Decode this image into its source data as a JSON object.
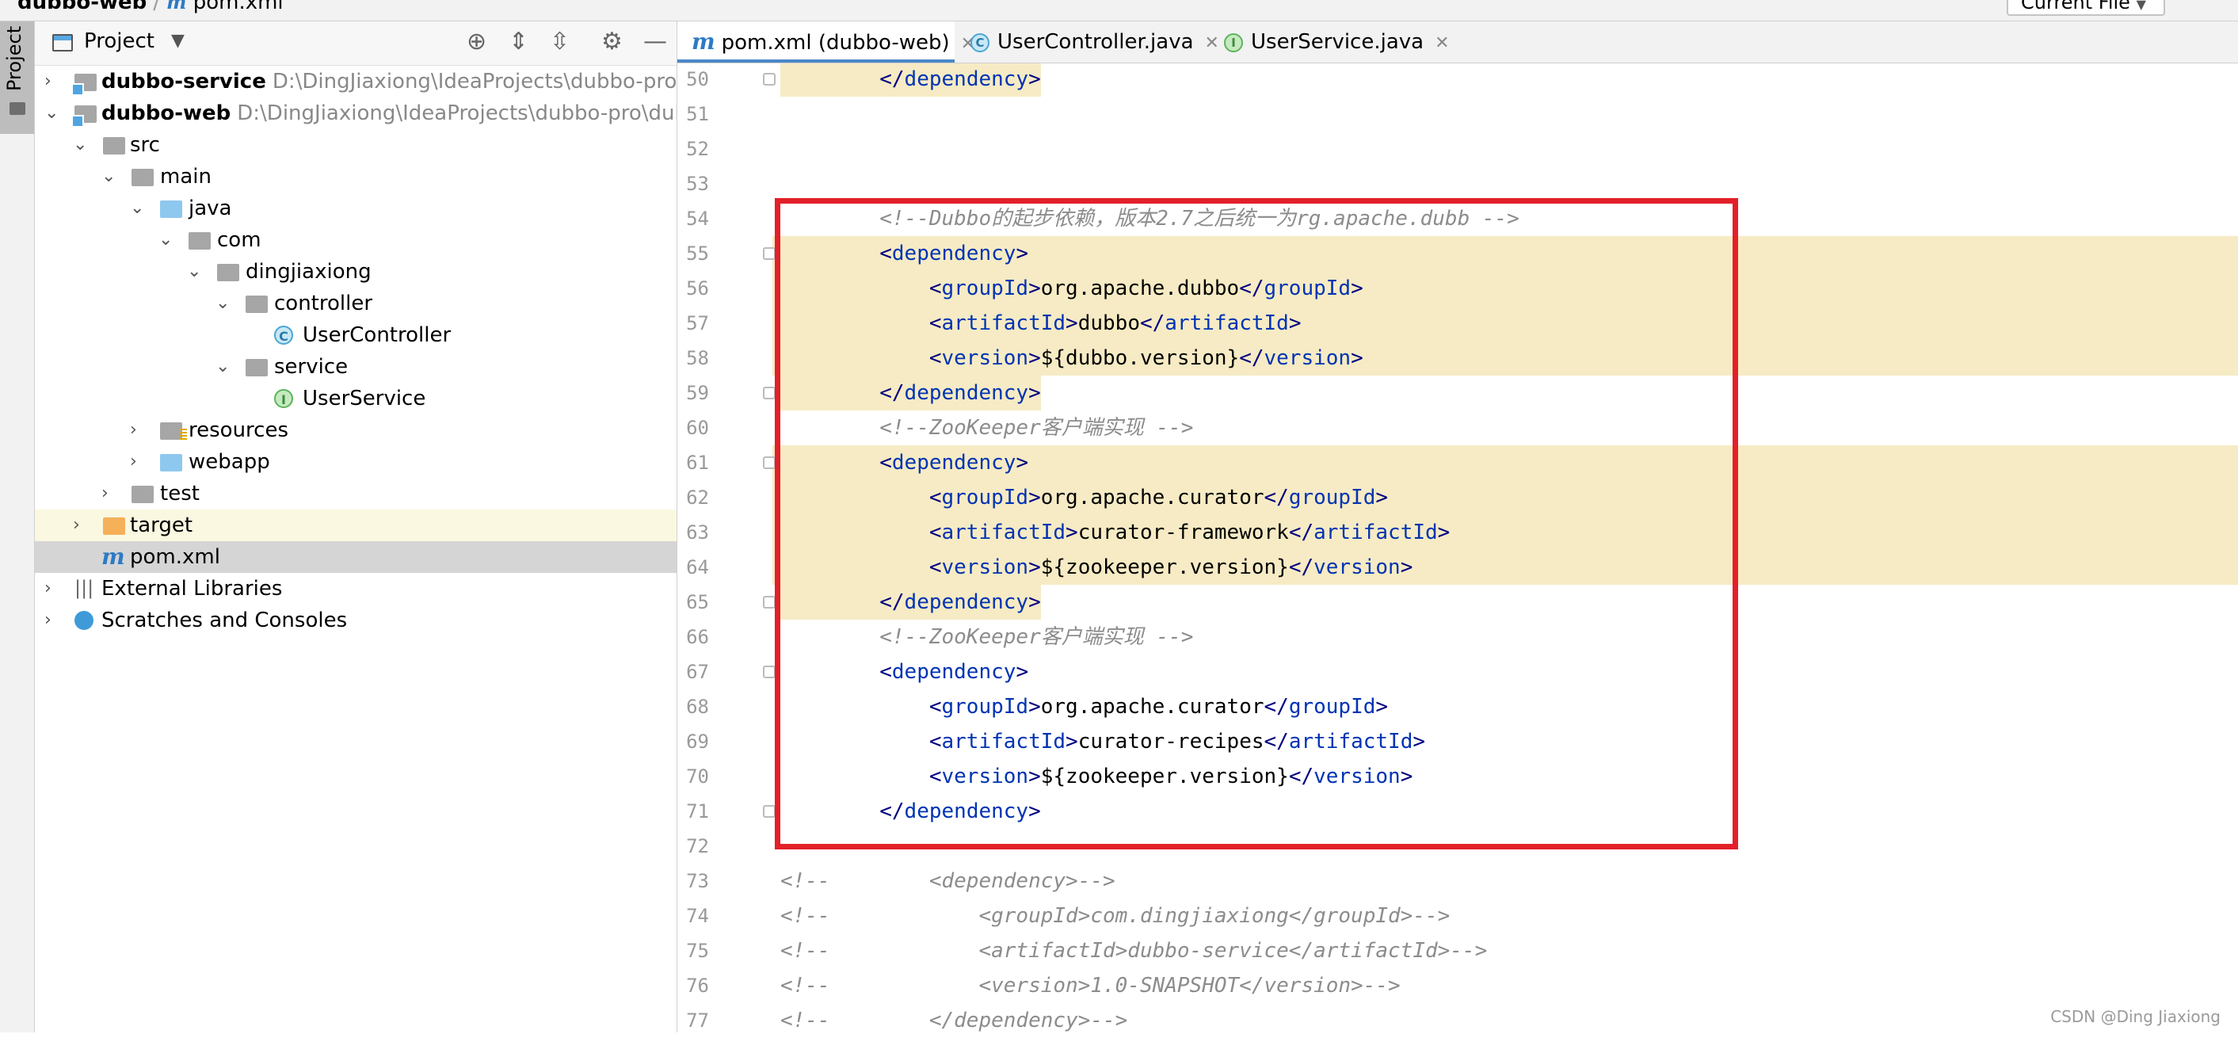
{
  "topbar": {
    "project": "dubbo-web",
    "file": "pom.xml",
    "config": "Current File"
  },
  "toolstrip": {
    "project_tab": "Project"
  },
  "project_panel": {
    "title": "Project",
    "tree": [
      {
        "label": "dubbo-service",
        "path": "D:\\DingJiaxiong\\IdeaProjects\\dubbo-pro\\dubbo",
        "icon": "module-folder-icon"
      },
      {
        "label": "dubbo-web",
        "path": "D:\\DingJiaxiong\\IdeaProjects\\dubbo-pro\\dubbo-w",
        "icon": "module-folder-icon"
      },
      {
        "label": "src",
        "icon": "folder-icon"
      },
      {
        "label": "main",
        "icon": "folder-icon"
      },
      {
        "label": "java",
        "icon": "source-folder-icon"
      },
      {
        "label": "com",
        "icon": "package-icon"
      },
      {
        "label": "dingjiaxiong",
        "icon": "package-icon"
      },
      {
        "label": "controller",
        "icon": "package-icon"
      },
      {
        "label": "UserController",
        "icon": "class-icon"
      },
      {
        "label": "service",
        "icon": "package-icon"
      },
      {
        "label": "UserService",
        "icon": "interface-icon"
      },
      {
        "label": "resources",
        "icon": "resources-folder-icon"
      },
      {
        "label": "webapp",
        "icon": "web-folder-icon"
      },
      {
        "label": "test",
        "icon": "folder-icon"
      },
      {
        "label": "target",
        "icon": "excluded-folder-icon"
      },
      {
        "label": "pom.xml",
        "icon": "maven-icon"
      },
      {
        "label": "External Libraries",
        "icon": "libraries-icon"
      },
      {
        "label": "Scratches and Consoles",
        "icon": "scratches-icon"
      }
    ]
  },
  "tabs": [
    {
      "label": "pom.xml (dubbo-web)",
      "icon": "maven-icon",
      "icon_letter": "m"
    },
    {
      "label": "UserController.java",
      "icon": "class-icon",
      "icon_letter": "C"
    },
    {
      "label": "UserService.java",
      "icon": "interface-icon",
      "icon_letter": "I"
    }
  ],
  "editor": {
    "line_numbers": [
      "50",
      "51",
      "52",
      "53",
      "54",
      "55",
      "56",
      "57",
      "58",
      "59",
      "60",
      "61",
      "62",
      "63",
      "64",
      "65",
      "66",
      "67",
      "68",
      "69",
      "70",
      "71",
      "72",
      "73",
      "74",
      "75",
      "76",
      "77"
    ],
    "lines": [
      [
        "        ",
        "</",
        "dependency",
        ">"
      ],
      [
        ""
      ],
      [
        ""
      ],
      [
        ""
      ],
      [
        "        ",
        "<!--Dubbo的起步依赖，版本2.7之后统一为rg.apache.dubb -->"
      ],
      [
        "        ",
        "<",
        "dependency",
        ">"
      ],
      [
        "            ",
        "<",
        "groupId",
        ">",
        "org.apache.dubbo",
        "</",
        "groupId",
        ">"
      ],
      [
        "            ",
        "<",
        "artifactId",
        ">",
        "dubbo",
        "</",
        "artifactId",
        ">"
      ],
      [
        "            ",
        "<",
        "version",
        ">",
        "${dubbo.version}",
        "</",
        "version",
        ">"
      ],
      [
        "        ",
        "</",
        "dependency",
        ">"
      ],
      [
        "        ",
        "<!--ZooKeeper客户端实现 -->"
      ],
      [
        "        ",
        "<",
        "dependency",
        ">"
      ],
      [
        "            ",
        "<",
        "groupId",
        ">",
        "org.apache.curator",
        "</",
        "groupId",
        ">"
      ],
      [
        "            ",
        "<",
        "artifactId",
        ">",
        "curator-framework",
        "</",
        "artifactId",
        ">"
      ],
      [
        "            ",
        "<",
        "version",
        ">",
        "${zookeeper.version}",
        "</",
        "version",
        ">"
      ],
      [
        "        ",
        "</",
        "dependency",
        ">"
      ],
      [
        "        ",
        "<!--ZooKeeper客户端实现 -->"
      ],
      [
        "        ",
        "<",
        "dependency",
        ">"
      ],
      [
        "            ",
        "<",
        "groupId",
        ">",
        "org.apache.curator",
        "</",
        "groupId",
        ">"
      ],
      [
        "            ",
        "<",
        "artifactId",
        ">",
        "curator-recipes",
        "</",
        "artifactId",
        ">"
      ],
      [
        "            ",
        "<",
        "version",
        ">",
        "${zookeeper.version}",
        "</",
        "version",
        ">"
      ],
      [
        "        ",
        "</",
        "dependency",
        ">"
      ],
      [
        ""
      ],
      [
        "<!--        <dependency>-->"
      ],
      [
        "<!--            <groupId>com.dingjiaxiong</groupId>-->"
      ],
      [
        "<!--            <artifactId>dubbo-service</artifactId>-->"
      ],
      [
        "<!--            <version>1.0-SNAPSHOT</version>-->"
      ],
      [
        "<!--        </dependency>-->"
      ]
    ]
  },
  "watermark": "CSDN @Ding Jiaxiong",
  "colors": {
    "highlight_box": "#e3202a",
    "line_highlight": "#f6ebc4",
    "tag_name": "#0033b3"
  }
}
